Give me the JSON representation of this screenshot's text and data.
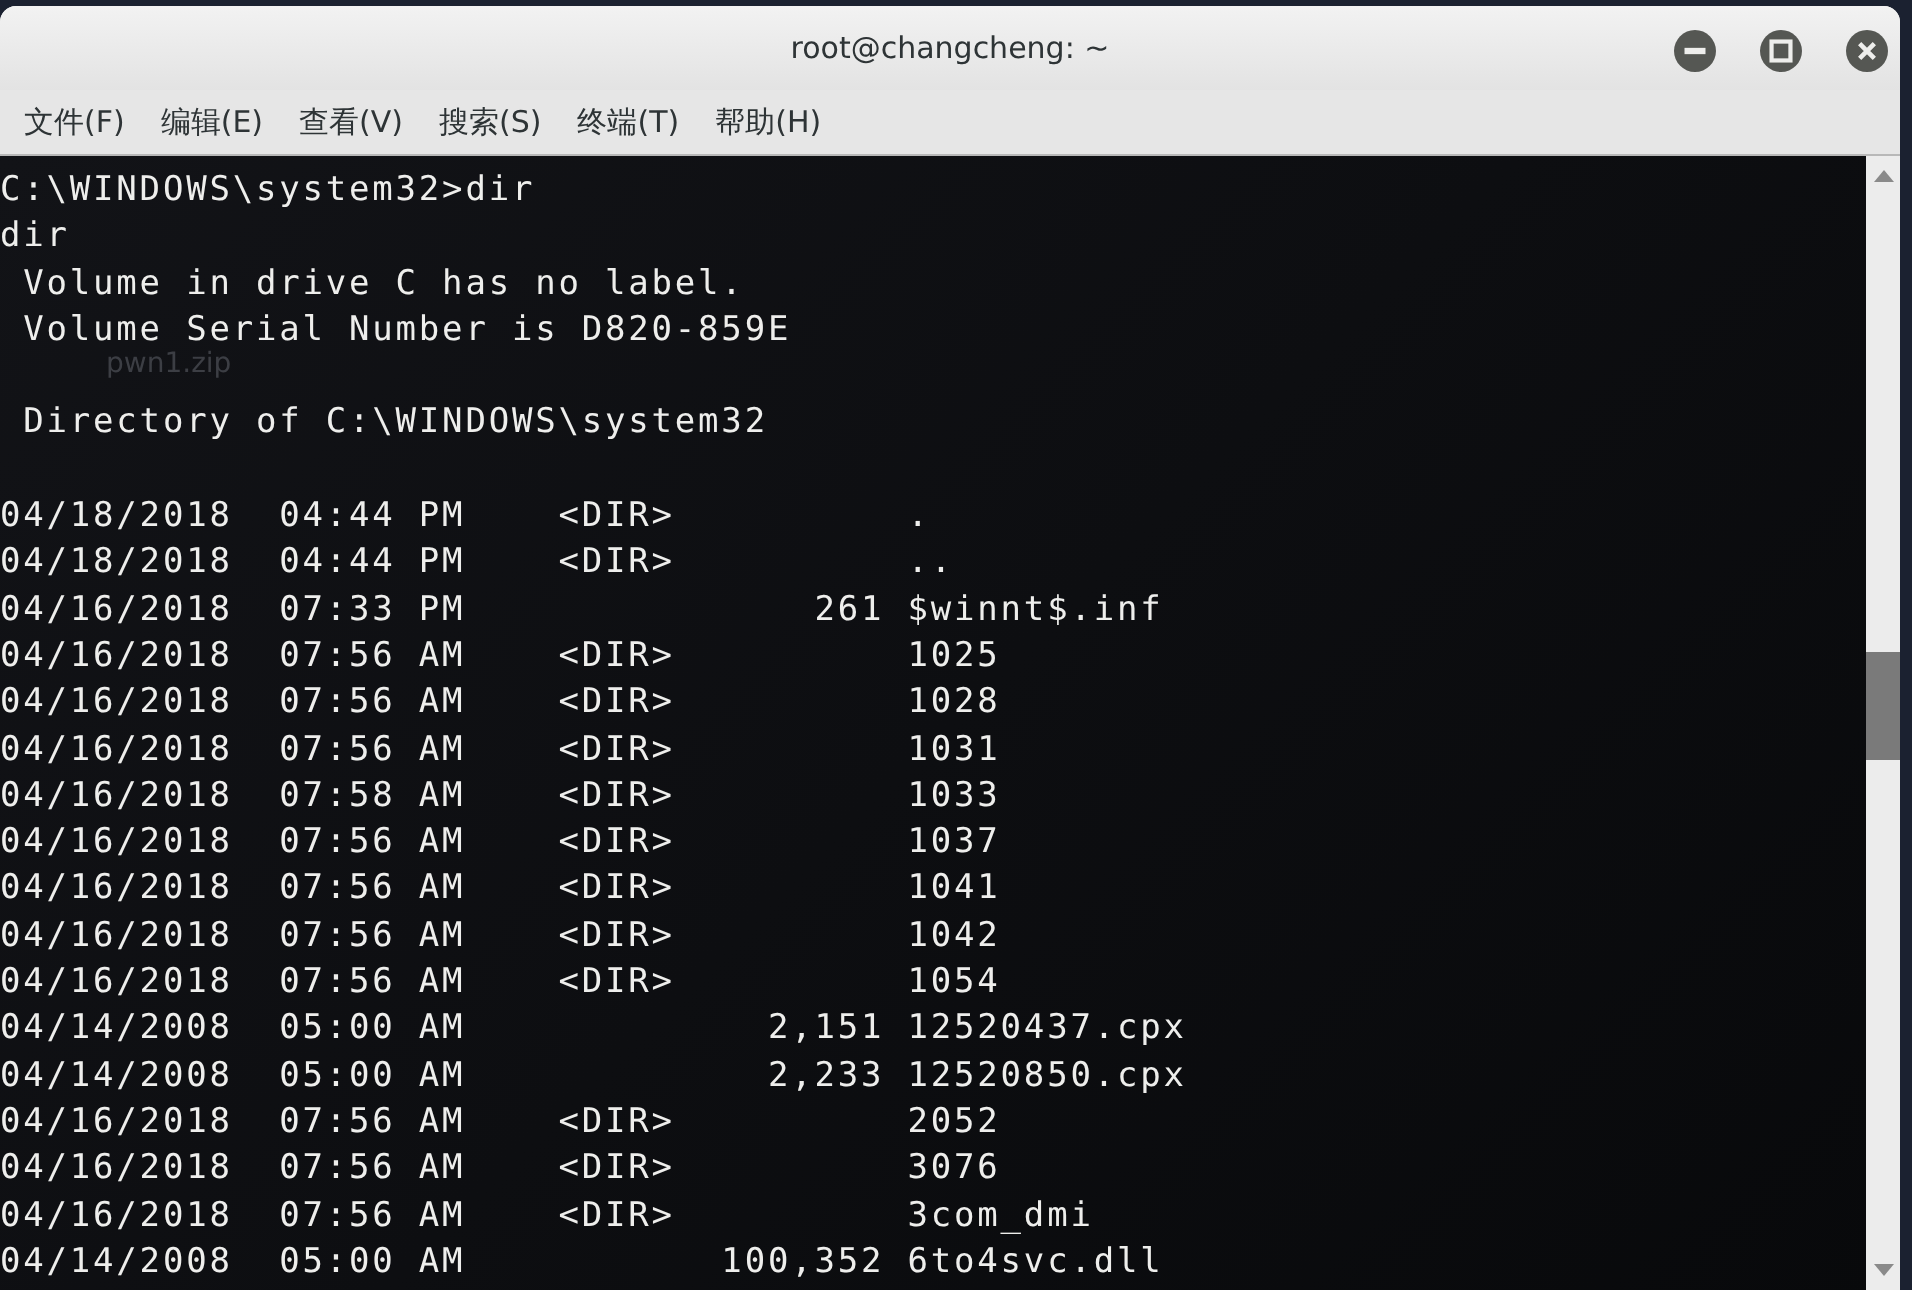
{
  "window": {
    "title": "root@changcheng: ~"
  },
  "menu": [
    {
      "label": "文件(F)"
    },
    {
      "label": "编辑(E)"
    },
    {
      "label": "查看(V)"
    },
    {
      "label": "搜索(S)"
    },
    {
      "label": "终端(T)"
    },
    {
      "label": "帮助(H)"
    }
  ],
  "desktop_icon": {
    "label": "pwn1.zip"
  },
  "terminal": {
    "lines": [
      "C:\\WINDOWS\\system32>dir",
      "dir",
      " Volume in drive C has no label.",
      " Volume Serial Number is D820-859E",
      {
        "text": " Directory of C:\\WINDOWS\\system32",
        "blank_before": true
      },
      {
        "text": "04/18/2018  04:44 PM    <DIR>          .",
        "blank_before": true
      },
      "04/18/2018  04:44 PM    <DIR>          ..",
      "04/16/2018  07:33 PM               261 $winnt$.inf",
      "04/16/2018  07:56 AM    <DIR>          1025",
      "04/16/2018  07:56 AM    <DIR>          1028",
      "04/16/2018  07:56 AM    <DIR>          1031",
      "04/16/2018  07:58 AM    <DIR>          1033",
      "04/16/2018  07:56 AM    <DIR>          1037",
      "04/16/2018  07:56 AM    <DIR>          1041",
      "04/16/2018  07:56 AM    <DIR>          1042",
      "04/16/2018  07:56 AM    <DIR>          1054",
      "04/14/2008  05:00 AM             2,151 12520437.cpx",
      "04/14/2008  05:00 AM             2,233 12520850.cpx",
      "04/16/2018  07:56 AM    <DIR>          2052",
      "04/16/2018  07:56 AM    <DIR>          3076",
      "04/16/2018  07:56 AM    <DIR>          3com_dmi",
      "04/14/2008  05:00 AM           100,352 6to4svc.dll"
    ]
  }
}
